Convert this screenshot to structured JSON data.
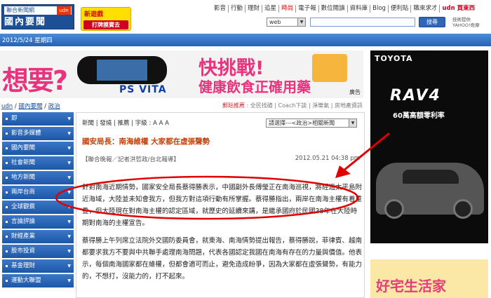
{
  "header": {
    "logo_top": "聯合新聞網",
    "logo_main": "國內要聞",
    "logo_badge": "udn",
    "game_ad_line1": "新遊戲",
    "game_ad_line2": "打牌摸寶去",
    "top_links": [
      {
        "label": "影音"
      },
      {
        "label": "行動"
      },
      {
        "label": "理財"
      },
      {
        "label": "追星"
      },
      {
        "label": "時尚",
        "hot": true
      },
      {
        "label": "電子報"
      },
      {
        "label": "數位閱讀"
      },
      {
        "label": "資料庫"
      },
      {
        "label": "Blog"
      },
      {
        "label": "便利貼"
      },
      {
        "label": "職來求才"
      },
      {
        "label": "udn 買東西",
        "last": true
      }
    ],
    "search_scope": "web",
    "search_placeholder": "",
    "search_button": "搜尋",
    "yahoo_line1": "技術提供",
    "yahoo_line2": "YAHOO!奇摩"
  },
  "datebar": {
    "date": "2012/5/24 星期四"
  },
  "banner": {
    "want": "想要?",
    "psvita": "PS VITA",
    "challenge": "快挑戰!",
    "slogan": "健康飲食正確用藥",
    "ad_label": "廣告"
  },
  "breadcrumb": {
    "items": [
      "udn",
      "國內要聞",
      "政治"
    ],
    "sep": " / "
  },
  "tools": {
    "highlight": "郵貼推薦",
    "text": " : 全民找碴 | Coach下談 | 淨樂氣 | 房地產資訊"
  },
  "sidebar": {
    "items": [
      "即",
      "影音多媒體",
      "國內要聞",
      "社會新聞",
      "地方新聞",
      "兩岸台商",
      "全球觀察",
      "言論評論",
      "財經產業",
      "股市投資",
      "基金理財",
      "運動大聯盟"
    ]
  },
  "article": {
    "tools": "新聞 | 發燒 | 推薦 | 字級 : A A A",
    "related_select": "請選擇---<政治>相關新聞",
    "title": "國安局長：南海維權 大家都在虛張聲勢",
    "byline": "【聯合晚報／記者洪哲政/台北報導】",
    "time": "2012.05.21 04:38 pm",
    "paragraphs": [
      "針對南海近期情勢，國家安全局長蔡得勝表示，中國副外長傅瑩正在南海巡視，將經過太平島附近海域，大陸並未知會我方，但我方對這項行動有所掌握。蔡得勝指出，兩岸在南海主權有着重疊，但大陸現在對南海主權的認定區域，就歷史的延續來講，是繼承國府於民國38年在大陸時期對南海的主權宣告。",
      "蔡得勝上午列席立法院外交國防委員會，就東海、南海情勢提出報告，蔡得勝說，菲律賓、越南都要求我方不要與中共聯手處理南海問題，代表各國認定我國在南海有存在的力量與價值。他表示，每個南海國家都在維權，但都會適可而止，避免造成紛爭，因為大家都在虛張聲勢，有能力的，不想打，沒能力的，打不起來。"
    ]
  },
  "right_ads": {
    "brand": "TOYOTA",
    "model": "RAV4",
    "rate_text": "60萬高額零利率",
    "cafe_text": "好宅生活家"
  },
  "colors": {
    "brand_blue": "#1d4f96",
    "title_orange": "#c2410c",
    "annotation_red": "#e00000"
  }
}
